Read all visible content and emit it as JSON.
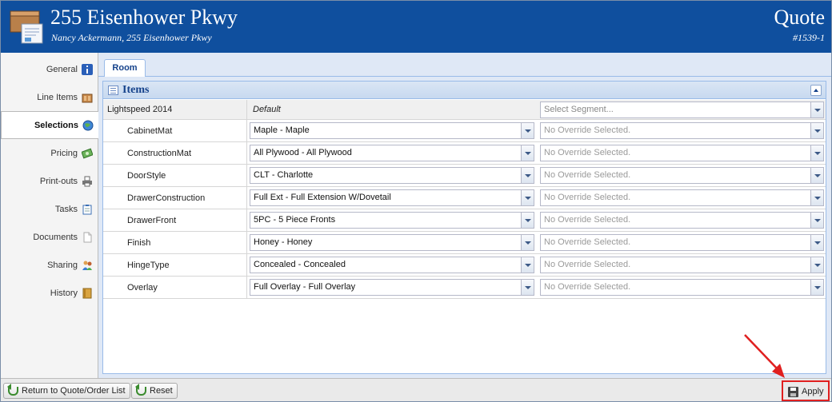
{
  "header": {
    "title": "255 Eisenhower Pkwy",
    "subtitle": "Nancy Ackermann, 255 Eisenhower Pkwy",
    "doc_type": "Quote",
    "doc_number": "#1539-1",
    "background_color": "#0f4f9e"
  },
  "sidebar": {
    "items": [
      {
        "label": "General",
        "icon": "info-icon"
      },
      {
        "label": "Line Items",
        "icon": "cabinet-icon"
      },
      {
        "label": "Selections",
        "icon": "globe-icon",
        "active": true
      },
      {
        "label": "Pricing",
        "icon": "money-icon"
      },
      {
        "label": "Print-outs",
        "icon": "printer-icon"
      },
      {
        "label": "Tasks",
        "icon": "clipboard-icon"
      },
      {
        "label": "Documents",
        "icon": "document-icon"
      },
      {
        "label": "Sharing",
        "icon": "people-icon"
      },
      {
        "label": "History",
        "icon": "book-icon"
      }
    ]
  },
  "tabs": [
    {
      "label": "Room"
    }
  ],
  "panel": {
    "title": "Items",
    "header_row": {
      "catalog": "Lightspeed 2014",
      "default_label": "Default",
      "segment_placeholder": "Select Segment..."
    },
    "rows": [
      {
        "name": "CabinetMat",
        "value": "Maple -  Maple",
        "override": "No Override Selected."
      },
      {
        "name": "ConstructionMat",
        "value": "All Plywood -  All Plywood",
        "override": "No Override Selected."
      },
      {
        "name": "DoorStyle",
        "value": "CLT -  Charlotte",
        "override": "No Override Selected."
      },
      {
        "name": "DrawerConstruction",
        "value": "Full Ext -  Full Extension W/Dovetail",
        "override": "No Override Selected."
      },
      {
        "name": "DrawerFront",
        "value": "5PC -  5 Piece Fronts",
        "override": "No Override Selected."
      },
      {
        "name": "Finish",
        "value": "Honey -  Honey",
        "override": "No Override Selected."
      },
      {
        "name": "HingeType",
        "value": "Concealed -  Concealed",
        "override": "No Override Selected."
      },
      {
        "name": "Overlay",
        "value": "Full Overlay -  Full Overlay",
        "override": "No Override Selected."
      }
    ]
  },
  "footer": {
    "return_label": "Return to Quote/Order List",
    "reset_label": "Reset",
    "apply_label": "Apply",
    "highlight_color": "#e02020"
  }
}
